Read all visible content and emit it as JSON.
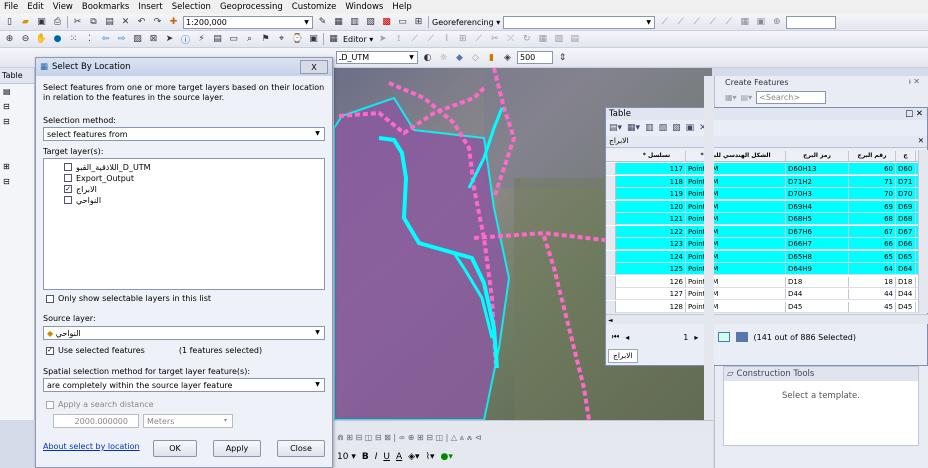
{
  "menu": [
    "File",
    "Edit",
    "View",
    "Bookmarks",
    "Insert",
    "Selection",
    "Geoprocessing",
    "Customize",
    "Windows",
    "Help"
  ],
  "toolbar": {
    "scale": "1:200,000",
    "georeferencing_label": "Georeferencing",
    "editor_label": "Editor",
    "layer_combo": "ـD_UTM",
    "opacity_value": "500",
    "search_placeholder": ""
  },
  "leftpane": {
    "tab": "Table"
  },
  "dialog": {
    "title": "Select By Location",
    "close": "X",
    "description": "Select features from one or more target layers based on their location in relation to the features in the source layer.",
    "selection_method_label": "Selection method:",
    "selection_method": "select features from",
    "target_layers_label": "Target layer(s):",
    "target_layers": [
      {
        "name": "اللاذقية_القبو_D_UTM",
        "checked": false
      },
      {
        "name": "Export_Output",
        "checked": false
      },
      {
        "name": "الابراج",
        "checked": true
      },
      {
        "name": "النواحي",
        "checked": false
      }
    ],
    "only_selectable_label": "Only show selectable layers in this list",
    "source_layer_label": "Source layer:",
    "source_layer": "النواحي",
    "use_selected_label": "Use selected features",
    "features_selected": "(1 features selected)",
    "spatial_method_label": "Spatial selection method for target layer feature(s):",
    "spatial_method": "are completely within the source layer feature",
    "search_distance_label": "Apply a search distance",
    "search_distance": "2000.000000",
    "units": "Meters",
    "about_link": "About select by location",
    "ok": "OK",
    "apply": "Apply",
    "close_btn": "Close"
  },
  "create_features": {
    "title": "Create Features",
    "search_placeholder": "<Search>",
    "construction_tools": "Construction Tools",
    "select_template": "Select a template."
  },
  "table": {
    "title": "Table",
    "layer_tab": "الابراج",
    "columns": [
      "* تسلسل",
      "* الشكل الهندسي للبرج",
      "رمز البرج",
      "رقم البرج",
      "ج"
    ],
    "rows": [
      {
        "seq": "117",
        "shape": "Point ZM",
        "code": "D60H13",
        "num": "60",
        "extra": "D60",
        "sel": true
      },
      {
        "seq": "118",
        "shape": "Point ZM",
        "code": "D71H2",
        "num": "71",
        "extra": "D71",
        "sel": true
      },
      {
        "seq": "119",
        "shape": "Point ZM",
        "code": "D70H3",
        "num": "70",
        "extra": "D70",
        "sel": true
      },
      {
        "seq": "120",
        "shape": "Point ZM",
        "code": "D69H4",
        "num": "69",
        "extra": "D69",
        "sel": true
      },
      {
        "seq": "121",
        "shape": "Point ZM",
        "code": "D68H5",
        "num": "68",
        "extra": "D68",
        "sel": true
      },
      {
        "seq": "122",
        "shape": "Point ZM",
        "code": "D67H6",
        "num": "67",
        "extra": "D67",
        "sel": true
      },
      {
        "seq": "123",
        "shape": "Point ZM",
        "code": "D66H7",
        "num": "66",
        "extra": "D66",
        "sel": true
      },
      {
        "seq": "124",
        "shape": "Point ZM",
        "code": "D65H8",
        "num": "65",
        "extra": "D65",
        "sel": true
      },
      {
        "seq": "125",
        "shape": "Point ZM",
        "code": "D64H9",
        "num": "64",
        "extra": "D64",
        "sel": true
      },
      {
        "seq": "126",
        "shape": "Point ZM",
        "code": "D18",
        "num": "18",
        "extra": "D18",
        "sel": false
      },
      {
        "seq": "127",
        "shape": "Point ZM",
        "code": "D44",
        "num": "44",
        "extra": "D44",
        "sel": false
      },
      {
        "seq": "128",
        "shape": "Point ZM",
        "code": "D45",
        "num": "45",
        "extra": "D45",
        "sel": false
      }
    ],
    "nav_record": "1",
    "selection_status": "(141 out of 886 Selected)",
    "bottom_tab": "الابراج"
  },
  "colors": {
    "selection": "#00ffff",
    "towers": "#ff69c8",
    "polygon": "#8a5aa0"
  }
}
